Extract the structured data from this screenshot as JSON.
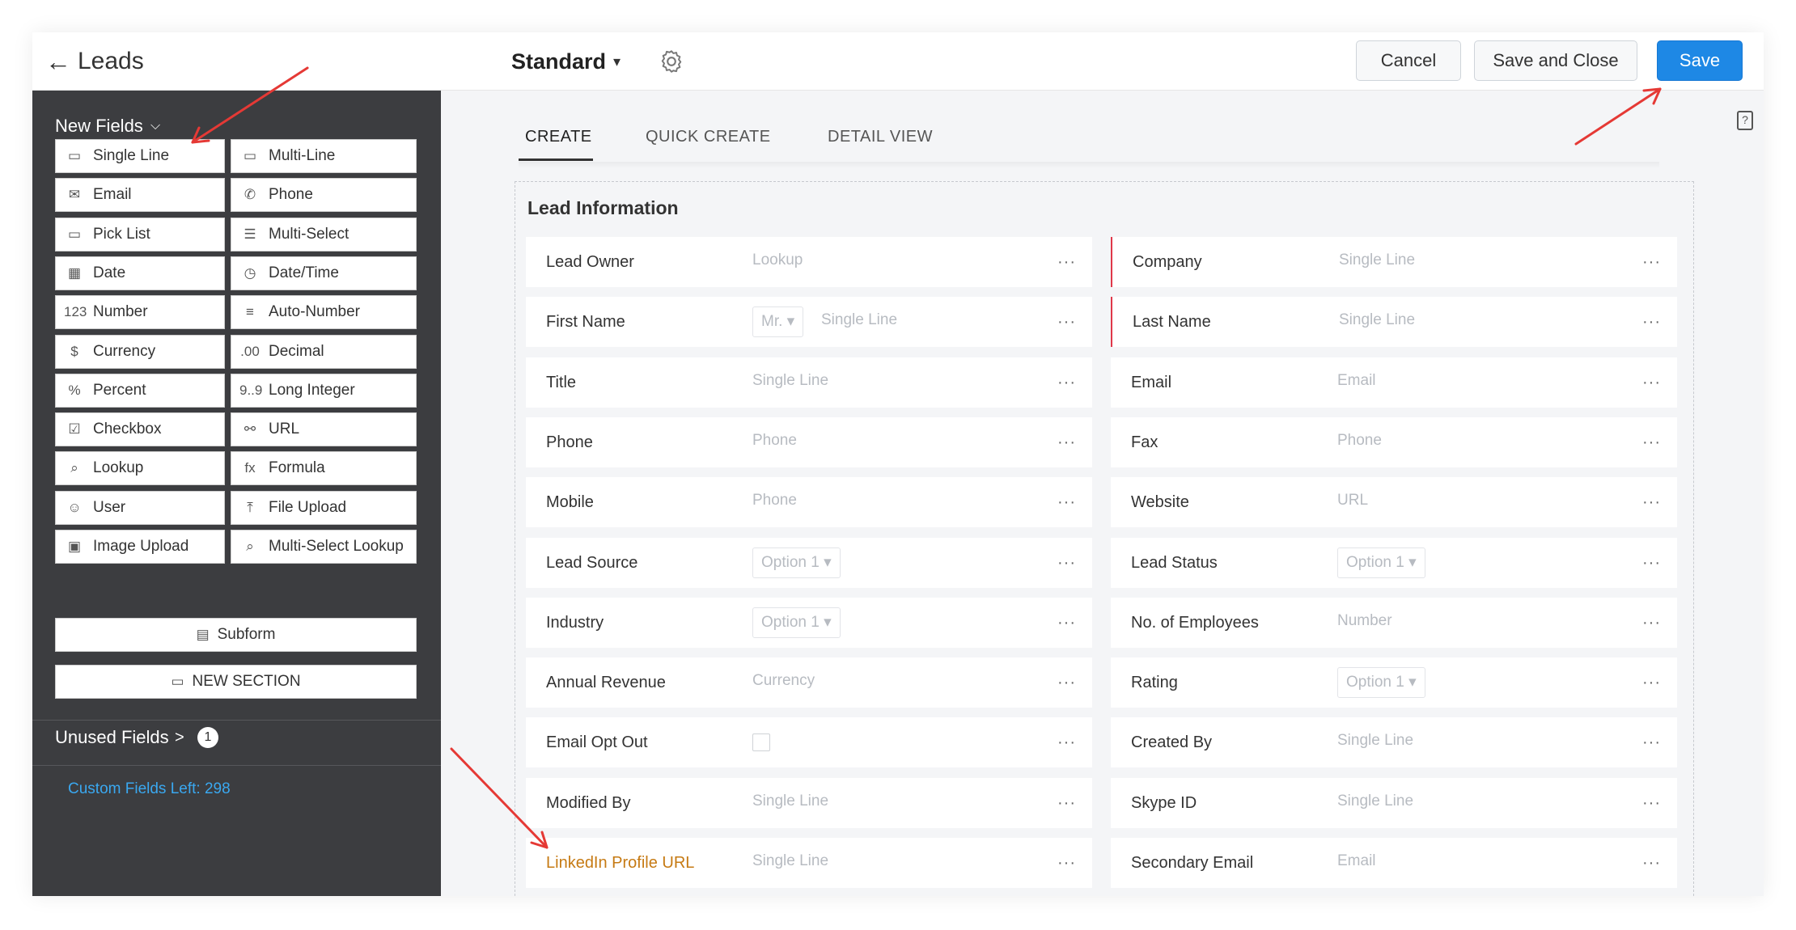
{
  "header": {
    "back_icon": "arrow-left-icon",
    "title": "Leads",
    "layout_name": "Standard",
    "layout_caret": "▾",
    "settings_icon": "gear-icon",
    "buttons": {
      "cancel": "Cancel",
      "save_close": "Save and Close",
      "save": "Save"
    }
  },
  "sidebar": {
    "new_fields_title": "New Fields",
    "new_fields_chevron": "⌵",
    "fields": [
      {
        "icon": "▭",
        "label": "Single Line"
      },
      {
        "icon": "▭",
        "label": "Multi-Line"
      },
      {
        "icon": "✉",
        "label": "Email"
      },
      {
        "icon": "✆",
        "label": "Phone"
      },
      {
        "icon": "▭",
        "label": "Pick List"
      },
      {
        "icon": "☰",
        "label": "Multi-Select"
      },
      {
        "icon": "▦",
        "label": "Date"
      },
      {
        "icon": "◷",
        "label": "Date/Time"
      },
      {
        "icon": "123",
        "label": "Number"
      },
      {
        "icon": "≡",
        "label": "Auto-Number"
      },
      {
        "icon": "$",
        "label": "Currency"
      },
      {
        "icon": ".00",
        "label": "Decimal"
      },
      {
        "icon": "%",
        "label": "Percent"
      },
      {
        "icon": "9..9",
        "label": "Long Integer"
      },
      {
        "icon": "☑",
        "label": "Checkbox"
      },
      {
        "icon": "⚯",
        "label": "URL"
      },
      {
        "icon": "⌕",
        "label": "Lookup"
      },
      {
        "icon": "fx",
        "label": "Formula"
      },
      {
        "icon": "☺",
        "label": "User"
      },
      {
        "icon": "⤒",
        "label": "File Upload"
      },
      {
        "icon": "▣",
        "label": "Image Upload"
      },
      {
        "icon": "⌕",
        "label": "Multi-Select Lookup"
      }
    ],
    "subform": {
      "icon": "▤",
      "label": "Subform"
    },
    "new_section": {
      "icon": "▭",
      "label": "NEW SECTION"
    },
    "unused_fields": "Unused Fields",
    "unused_chevron": ">",
    "unused_count": "1",
    "custom_fields_left": "Custom Fields Left: 298"
  },
  "main": {
    "tabs": [
      "CREATE",
      "QUICK CREATE",
      "DETAIL VIEW"
    ],
    "help_icon": "layout-help-icon",
    "section_title": "Lead Information",
    "dots": "···",
    "rows": [
      {
        "left": {
          "label": "Lead Owner",
          "placeholder": "Lookup"
        },
        "right": {
          "label": "Company",
          "placeholder": "Single Line"
        }
      },
      {
        "left": {
          "label": "First Name",
          "salutation": "Mr. ▾",
          "placeholder": "Single Line"
        },
        "right": {
          "label": "Last Name",
          "placeholder": "Single Line"
        }
      },
      {
        "left": {
          "label": "Title",
          "placeholder": "Single Line"
        },
        "right": {
          "label": "Email",
          "placeholder": "Email"
        }
      },
      {
        "left": {
          "label": "Phone",
          "placeholder": "Phone"
        },
        "right": {
          "label": "Fax",
          "placeholder": "Phone"
        }
      },
      {
        "left": {
          "label": "Mobile",
          "placeholder": "Phone"
        },
        "right": {
          "label": "Website",
          "placeholder": "URL"
        }
      },
      {
        "left": {
          "label": "Lead Source",
          "select": "Option 1 ▾"
        },
        "right": {
          "label": "Lead Status",
          "select": "Option 1 ▾"
        }
      },
      {
        "left": {
          "label": "Industry",
          "select": "Option 1 ▾"
        },
        "right": {
          "label": "No. of Employees",
          "placeholder": "Number"
        }
      },
      {
        "left": {
          "label": "Annual Revenue",
          "placeholder": "Currency"
        },
        "right": {
          "label": "Rating",
          "select": "Option 1 ▾"
        }
      },
      {
        "left": {
          "label": "Email Opt Out",
          "checkbox": "unchecked"
        },
        "right": {
          "label": "Created By",
          "placeholder": "Single Line"
        }
      },
      {
        "left": {
          "label": "Modified By",
          "placeholder": "Single Line"
        },
        "right": {
          "label": "Skype ID",
          "placeholder": "Single Line"
        }
      },
      {
        "left": {
          "label": "LinkedIn Profile URL",
          "placeholder": "Single Line"
        },
        "right": {
          "label": "Secondary Email",
          "placeholder": "Email"
        }
      }
    ]
  },
  "colors": {
    "sidebar_bg": "#3c3d40",
    "save_button": "#1e88e5",
    "required_marker": "#e0384a",
    "new_field_label": "#c67a13",
    "custom_fields_text": "#3aa8f0",
    "annotation_arrow": "#e53935"
  }
}
